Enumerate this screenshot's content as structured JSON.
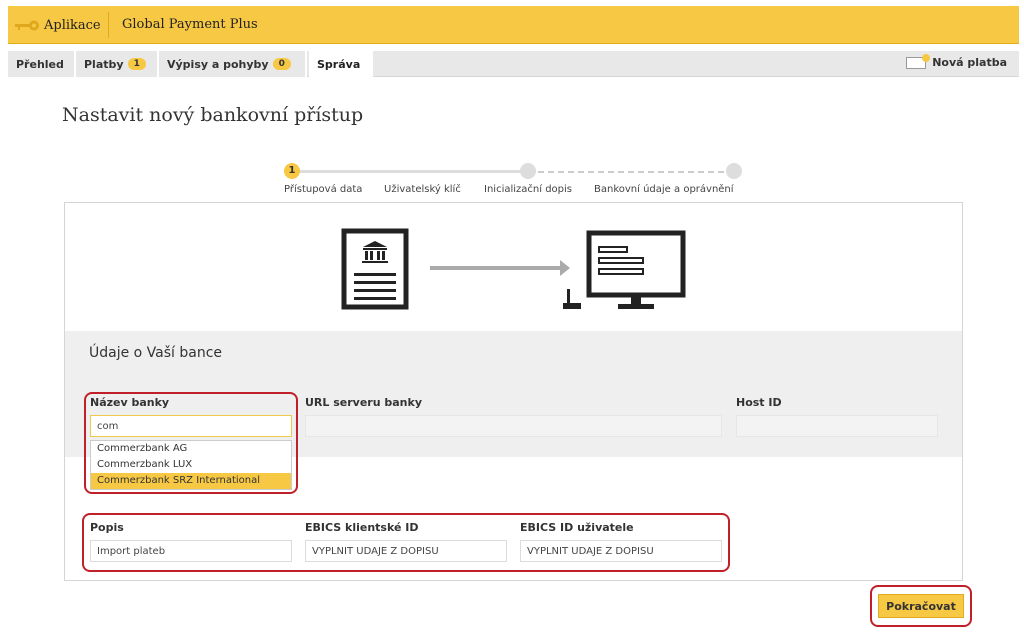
{
  "header": {
    "app_label": "Aplikace",
    "title": "Global Payment Plus",
    "accent": "#f7c843"
  },
  "tabs": [
    {
      "label": "Přehled",
      "badge": ""
    },
    {
      "label": "Platby",
      "badge": "1"
    },
    {
      "label": "Výpisy a pohyby",
      "badge": "0"
    },
    {
      "label": "Správa",
      "badge": ""
    }
  ],
  "new_payment_label": "Nová platba",
  "page_title": "Nastavit nový bankovní přístup",
  "stepper": {
    "active_number": "1",
    "steps": [
      "Přístupová data",
      "Uživatelský klíč",
      "Inicializační dopis",
      "Bankovní údaje a oprávnění"
    ]
  },
  "section_title": "Údaje o Vaší bance",
  "fields": {
    "bank_name": {
      "label": "Název banky",
      "value": "com"
    },
    "server_url": {
      "label": "URL serveru banky",
      "value": ""
    },
    "host_id": {
      "label": "Host ID",
      "value": ""
    },
    "description": {
      "label": "Popis",
      "value": "Import plateb"
    },
    "ebics_client": {
      "label": "EBICS klientské ID",
      "value": "VYPLNIT ÚDAJE Z DOPISU"
    },
    "ebics_user": {
      "label": "EBICS ID uživatele",
      "value": "VYPLNIT ÚDAJE Z DOPISU"
    }
  },
  "bank_suggestions": [
    "Commerzbank AG",
    "Commerzbank LUX",
    "Commerzbank SRZ International"
  ],
  "continue_label": "Pokračovat",
  "highlight_color": "#c0202a"
}
